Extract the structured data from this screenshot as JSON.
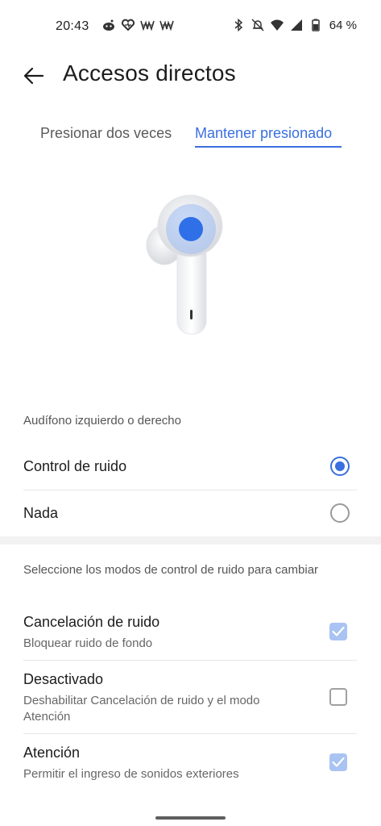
{
  "status_bar": {
    "time": "20:43",
    "battery_percent": "64 %",
    "left_icons": [
      "reddit-icon",
      "heart-icon",
      "wwe-icon",
      "wwe-icon"
    ],
    "right_icons": [
      "bluetooth-icon",
      "bell-off-icon",
      "wifi-icon",
      "signal-icon",
      "battery-icon"
    ]
  },
  "header": {
    "title": "Accesos directos",
    "back_icon": "arrow-left-icon"
  },
  "tabs": [
    {
      "label": "Presionar dos veces",
      "selected": false
    },
    {
      "label": "Mantener presionado",
      "selected": true
    }
  ],
  "earbud": {
    "image": "earbud-illustration",
    "accent": "#2f6fe8"
  },
  "gesture_section": {
    "label": "Audífono izquierdo o derecho",
    "options": [
      {
        "label": "Control de ruido",
        "selected": true
      },
      {
        "label": "Nada",
        "selected": false
      }
    ]
  },
  "noise_section": {
    "label": "Seleccione los modos de control de ruido para cambiar",
    "modes": [
      {
        "title": "Cancelación de ruido",
        "subtitle": "Bloquear ruido de fondo",
        "checked": true
      },
      {
        "title": "Desactivado",
        "subtitle": "Deshabilitar Cancelación de ruido y el modo Atención",
        "checked": false
      },
      {
        "title": "Atención",
        "subtitle": "Permitir el ingreso de sonidos exteriores",
        "checked": true
      }
    ]
  },
  "colors": {
    "accent": "#3a6fe0",
    "checkbox_checked": "#a9c3f2"
  }
}
